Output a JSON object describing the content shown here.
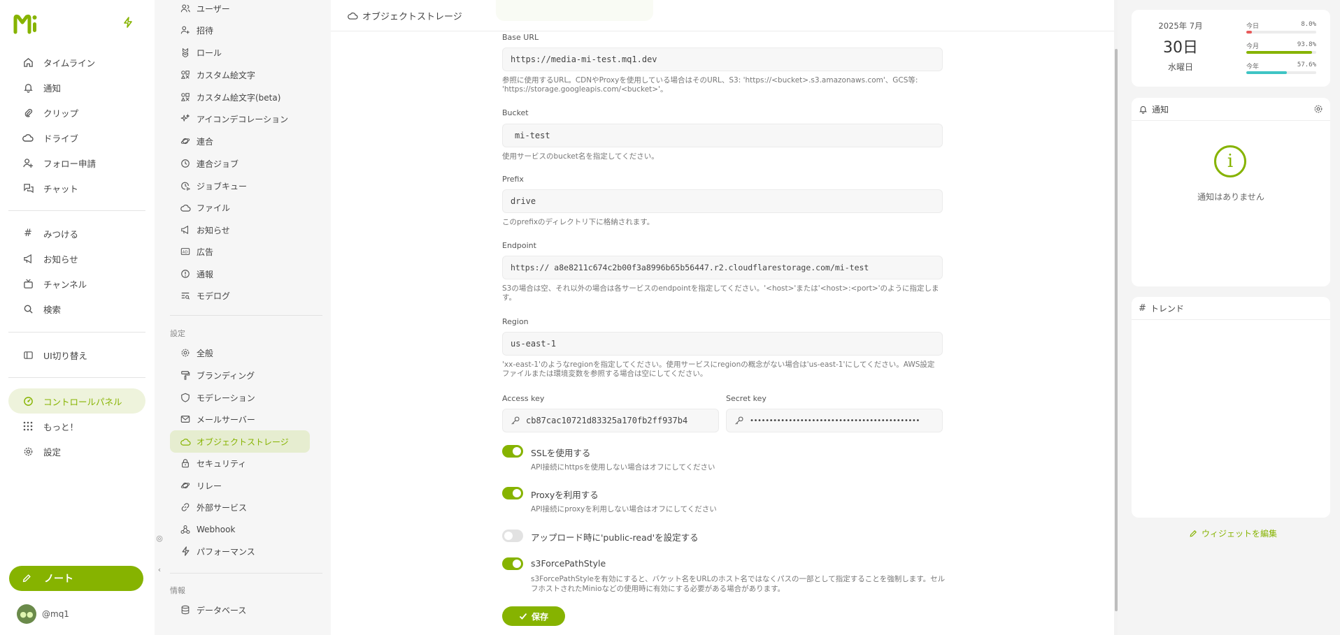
{
  "nav": {
    "items": [
      {
        "label": "タイムライン",
        "icon": "home-icon"
      },
      {
        "label": "通知",
        "icon": "bell-icon"
      },
      {
        "label": "クリップ",
        "icon": "paperclip-icon"
      },
      {
        "label": "ドライブ",
        "icon": "cloud-icon"
      },
      {
        "label": "フォロー申請",
        "icon": "user-plus-icon"
      },
      {
        "label": "チャット",
        "icon": "chat-icon"
      },
      {
        "label": "みつける",
        "icon": "hashtag-icon"
      },
      {
        "label": "お知らせ",
        "icon": "speakerphone-icon"
      },
      {
        "label": "チャンネル",
        "icon": "tv-icon"
      },
      {
        "label": "検索",
        "icon": "search-icon"
      },
      {
        "label": "UI切り替え",
        "icon": "layout-icon"
      },
      {
        "label": "コントロールパネル",
        "icon": "gauge-icon"
      },
      {
        "label": "もっと！",
        "icon": "grid-dots-icon"
      },
      {
        "label": "設定",
        "icon": "gear-icon"
      }
    ],
    "note_button": "ノート",
    "account": "@mq1"
  },
  "settings_sidebar": {
    "items": [
      {
        "label": "ユーザー"
      },
      {
        "label": "招待"
      },
      {
        "label": "ロール"
      },
      {
        "label": "カスタム絵文字"
      },
      {
        "label": "カスタム絵文字(beta)"
      },
      {
        "label": "アイコンデコレーション"
      },
      {
        "label": "連合"
      },
      {
        "label": "連合ジョブ"
      },
      {
        "label": "ジョブキュー"
      },
      {
        "label": "ファイル"
      },
      {
        "label": "お知らせ"
      },
      {
        "label": "広告"
      },
      {
        "label": "通報"
      },
      {
        "label": "モデログ"
      }
    ],
    "section_settings": "設定",
    "settings_items": [
      {
        "label": "全般"
      },
      {
        "label": "ブランディング"
      },
      {
        "label": "モデレーション"
      },
      {
        "label": "メールサーバー"
      },
      {
        "label": "オブジェクトストレージ"
      },
      {
        "label": "セキュリティ"
      },
      {
        "label": "リレー"
      },
      {
        "label": "外部サービス"
      },
      {
        "label": "Webhook"
      },
      {
        "label": "パフォーマンス"
      }
    ],
    "section_info": "情報",
    "info_items": [
      {
        "label": "データベース"
      }
    ]
  },
  "main": {
    "title": "オブジェクトストレージ",
    "base_url": {
      "label": "Base URL",
      "value": "https://media-mi-test.mq1.dev",
      "caption1": "参照に使用するURL。CDNやProxyを使用している場合はそのURL、S3: 'https://<bucket>.s3.amazonaws.com'、GCS等:",
      "caption2": "'https://storage.googleapis.com/<bucket>'。"
    },
    "bucket": {
      "label": "Bucket",
      "value": "mi-test",
      "caption": "使用サービスのbucket名を指定してください。"
    },
    "prefix": {
      "label": "Prefix",
      "value": "drive",
      "caption": "このprefixのディレクトリ下に格納されます。"
    },
    "endpoint": {
      "label": "Endpoint",
      "value": "https:// a8e8211c674c2b00f3a8996b65b56447.r2.cloudflarestorage.com/mi-test",
      "caption1": "S3の場合は空、それ以外の場合は各サービスのendpointを指定してください。'<host>'または'<host>:<port>'のように指定しま",
      "caption2": "す。"
    },
    "region": {
      "label": "Region",
      "value": "us-east-1",
      "caption1": "'xx-east-1'のようなregionを指定してください。使用サービスにregionの概念がない場合は'us-east-1'にしてください。AWS設定",
      "caption2": "ファイルまたは環境変数を参照する場合は空にしてください。"
    },
    "access_key": {
      "label": "Access key",
      "value": "cb87cac10721d83325a170fb2ff937b4"
    },
    "secret_key": {
      "label": "Secret key",
      "value": "••••••••••••••••••••••••••••••••••••••••••••"
    },
    "ssl": {
      "label": "SSLを使用する",
      "caption": "API接続にhttpsを使用しない場合はオフにしてください",
      "on": true
    },
    "proxy": {
      "label": "Proxyを利用する",
      "caption": "API接続にproxyを利用しない場合はオフにしてください",
      "on": true
    },
    "public_read": {
      "label": "アップロード時に'public-read'を設定する",
      "on": false
    },
    "force_path": {
      "label": "s3ForcePathStyle",
      "caption1": "s3ForcePathStyleを有効にすると、バケット名をURLのホスト名ではなくパスの一部として指定することを強制します。セル",
      "caption2": "フホストされたMinioなどの使用時に有効にする必要がある場合があります。",
      "on": true
    },
    "save_button": "保存"
  },
  "widgets": {
    "calendar": {
      "year_month": "2025年 7月",
      "day": "30日",
      "weekday": "水曜日"
    },
    "stats": [
      {
        "label": "今日",
        "value": "8.0%",
        "fraction": 0.08,
        "color": "#e85a5a"
      },
      {
        "label": "今月",
        "value": "93.8%",
        "fraction": 0.938,
        "color": "#86b300"
      },
      {
        "label": "今年",
        "value": "57.6%",
        "fraction": 0.576,
        "color": "#3ec4c4"
      }
    ],
    "notifications": {
      "title": "通知",
      "empty": "通知はありません"
    },
    "trends": {
      "title": "トレンド"
    },
    "edit_label": "ウィジェットを編集"
  },
  "colors": {
    "accent": "#86b300"
  }
}
